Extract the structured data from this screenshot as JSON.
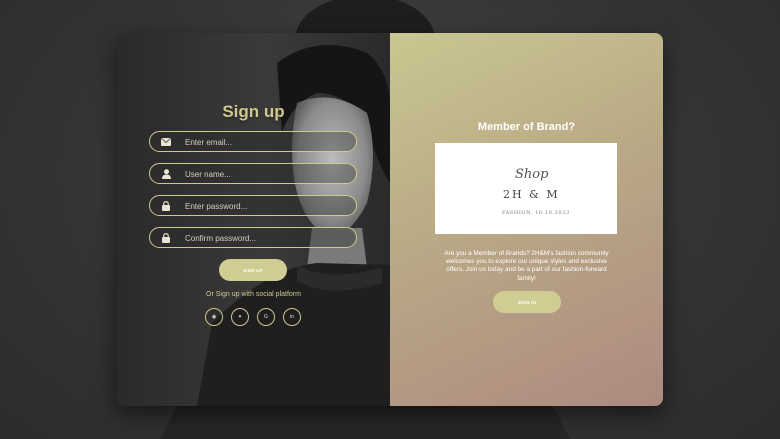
{
  "signup": {
    "title": "Sign up",
    "fields": [
      {
        "icon": "envelope-icon",
        "placeholder": "Enter email..."
      },
      {
        "icon": "user-icon",
        "placeholder": "User name..."
      },
      {
        "icon": "lock-icon",
        "placeholder": "Enter password..."
      },
      {
        "icon": "lock-icon",
        "placeholder": "Confirm password..."
      }
    ],
    "button_label": "SIGN UP",
    "social_text": "Or Sign up with social platform",
    "social": [
      {
        "icon": "github-icon",
        "glyph": "◉"
      },
      {
        "icon": "twitter-icon",
        "glyph": "✦"
      },
      {
        "icon": "google-icon",
        "glyph": "G"
      },
      {
        "icon": "linkedin-icon",
        "glyph": "in"
      }
    ]
  },
  "member": {
    "title": "Member of Brand?",
    "shop_script": "Shop",
    "shop_brand": "2H & M",
    "shop_date": "FASHION. 16.10.2023",
    "description": "Are you a Member of Brands? 2H&M's fashion community welcomes you to explore our unique styles and exclusive offers. Join us today and be a part of our fashion-forward family!",
    "button_label": "SIGN IN"
  },
  "colors": {
    "accent": "#cfc88f",
    "button": "#cfcd94",
    "gradient_start": "#c9c790",
    "gradient_end": "#ad8a80"
  }
}
